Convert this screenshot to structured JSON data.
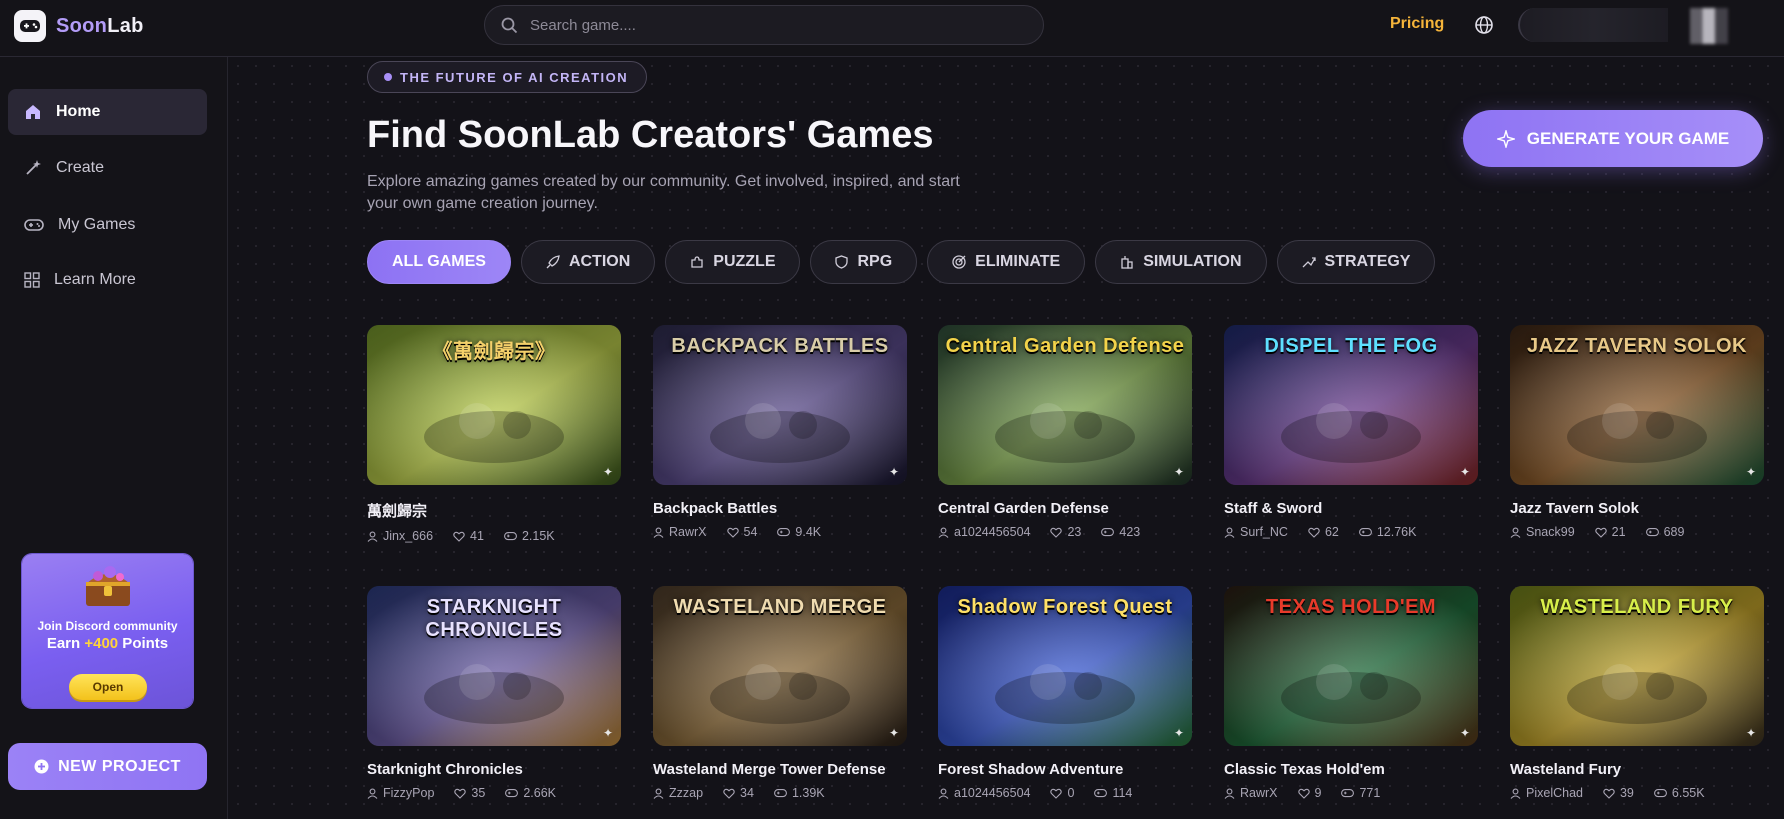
{
  "brand": {
    "name_a": "Soon",
    "name_b": "Lab"
  },
  "search": {
    "placeholder": "Search game...."
  },
  "header": {
    "pricing": "Pricing"
  },
  "sidebar": {
    "items": [
      {
        "label": "Home",
        "icon": "home-icon",
        "active": true
      },
      {
        "label": "Create",
        "icon": "wand-icon",
        "active": false
      },
      {
        "label": "My Games",
        "icon": "gamepad-icon",
        "active": false
      },
      {
        "label": "Learn More",
        "icon": "grid-icon",
        "active": false
      }
    ],
    "promo": {
      "line1": "Join Discord community",
      "line2_prefix": "Earn ",
      "points": "+400",
      "line2_suffix": " Points",
      "button": "Open"
    },
    "new_project": "NEW PROJECT"
  },
  "hero": {
    "badge": "THE FUTURE OF AI CREATION",
    "title": "Find SoonLab Creators' Games",
    "subtitle": "Explore amazing games created by our community. Get involved, inspired, and start your own game creation journey.",
    "generate_button": "GENERATE YOUR GAME"
  },
  "tabs": [
    {
      "label": "ALL GAMES",
      "icon": "",
      "active": true
    },
    {
      "label": "ACTION",
      "icon": "rocket-icon",
      "active": false
    },
    {
      "label": "PUZZLE",
      "icon": "puzzle-icon",
      "active": false
    },
    {
      "label": "RPG",
      "icon": "shield-icon",
      "active": false
    },
    {
      "label": "ELIMINATE",
      "icon": "target-icon",
      "active": false
    },
    {
      "label": "SIMULATION",
      "icon": "building-icon",
      "active": false
    },
    {
      "label": "STRATEGY",
      "icon": "strategy-icon",
      "active": false
    }
  ],
  "games": [
    {
      "title": "萬劍歸宗",
      "author": "Jinx_666",
      "likes": "41",
      "plays": "2.15K",
      "art_text": "《萬劍歸宗》",
      "colors": [
        "#6f8f2a",
        "#b8c94a",
        "#3d5a1e"
      ],
      "text_color": "#f4d06a"
    },
    {
      "title": "Backpack Battles",
      "author": "RawrX",
      "likes": "54",
      "plays": "9.4K",
      "art_text": "BACKPACK BATTLES",
      "colors": [
        "#2c2a4a",
        "#5a4b8a",
        "#1a1830"
      ],
      "text_color": "#d9cda8"
    },
    {
      "title": "Central Garden Defense",
      "author": "a1024456504",
      "likes": "23",
      "plays": "423",
      "art_text": "Central Garden Defense",
      "colors": [
        "#2d4a3a",
        "#7aa04a",
        "#1f3328"
      ],
      "text_color": "#f3d34a"
    },
    {
      "title": "Staff & Sword",
      "author": "Surf_NC",
      "likes": "62",
      "plays": "12.76K",
      "art_text": "DISPEL THE FOG",
      "colors": [
        "#1c2a6a",
        "#6a3a8a",
        "#8a2a2a"
      ],
      "text_color": "#5ee0ff"
    },
    {
      "title": "Jazz Tavern Solok",
      "author": "Snack99",
      "likes": "21",
      "plays": "689",
      "art_text": "JAZZ TAVERN SOLOK",
      "colors": [
        "#3a2516",
        "#8a5a2a",
        "#1e5a3a"
      ],
      "text_color": "#e8c988"
    },
    {
      "title": "Starknight Chronicles",
      "author": "FizzyPop",
      "likes": "35",
      "plays": "2.66K",
      "art_text": "STARKNIGHT CHRONICLES",
      "colors": [
        "#2a3a7a",
        "#6a5aa0",
        "#c08a3a"
      ],
      "text_color": "#e8e2ff"
    },
    {
      "title": "Wasteland Merge Tower Defense",
      "author": "Zzzap",
      "likes": "34",
      "plays": "1.39K",
      "art_text": "WASTELAND MERGE",
      "colors": [
        "#4a3a2a",
        "#8a6a3a",
        "#2a2018"
      ],
      "text_color": "#f0dcb0"
    },
    {
      "title": "Forest Shadow Adventure",
      "author": "a1024456504",
      "likes": "0",
      "plays": "114",
      "art_text": "Shadow Forest Quest",
      "colors": [
        "#1a2a8a",
        "#3a5ad0",
        "#2a7a3a"
      ],
      "text_color": "#ffe066"
    },
    {
      "title": "Classic Texas Hold'em",
      "author": "RawrX",
      "likes": "9",
      "plays": "771",
      "art_text": "TEXAS HOLD'EM",
      "colors": [
        "#2a1a12",
        "#1f6a3a",
        "#5a3a1a"
      ],
      "text_color": "#e83a2a"
    },
    {
      "title": "Wasteland Fury",
      "author": "PixelChad",
      "likes": "39",
      "plays": "6.55K",
      "art_text": "WASTELAND FURY",
      "colors": [
        "#6a7a1a",
        "#c0a02a",
        "#3a3020"
      ],
      "text_color": "#d8ef4a"
    }
  ]
}
